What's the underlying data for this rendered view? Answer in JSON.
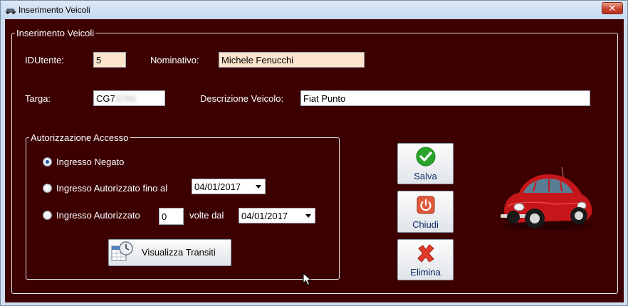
{
  "window": {
    "title": "Inserimento Veicoli",
    "close_glyph": "✕"
  },
  "main_group": {
    "legend": "Inserimento Veicoli"
  },
  "form": {
    "idutente_label": "IDUtente:",
    "idutente_value": "5",
    "nominativo_label": "Nominativo:",
    "nominativo_value": "Michele Fenucchi",
    "targa_label": "Targa:",
    "targa_visible": "CG7",
    "targa_obscured": "3766",
    "descrizione_label": "Descrizione Veicolo:",
    "descrizione_value": "Fiat Punto"
  },
  "access_group": {
    "legend": "Autorizzazione Accesso",
    "option_denied": "Ingresso Negato",
    "option_until": "Ingresso Autorizzato fino al",
    "until_date": "04/01/2017",
    "option_times": "Ingresso Autorizzato",
    "times_value": "0",
    "times_suffix": "volte dal",
    "times_date": "04/01/2017",
    "selected_option": "Ingresso Negato",
    "visualizza_label": "Visualizza Transiti"
  },
  "buttons": {
    "salva": "Salva",
    "chiudi": "Chiudi",
    "elimina": "Elimina"
  },
  "colors": {
    "background": "#3c0000",
    "peach_field": "#fde4cc",
    "accent_text": "#0a2a66"
  },
  "icons": [
    "car-title-icon",
    "check-icon",
    "power-icon",
    "x-icon",
    "calendar-clock-icon",
    "red-beetle-car-image"
  ]
}
